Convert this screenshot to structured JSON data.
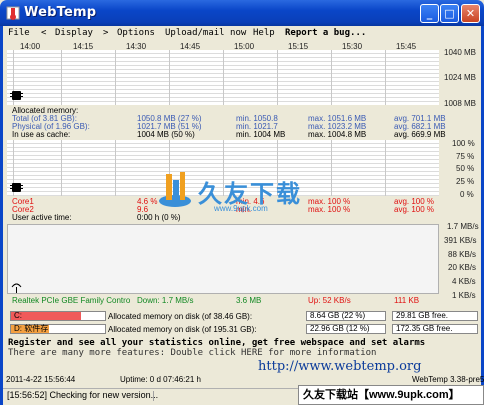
{
  "window": {
    "title": "WebTemp"
  },
  "menu": {
    "file": "File",
    "prev": "<",
    "display": "Display",
    "next": ">",
    "options": "Options",
    "upload": "Upload/mail now",
    "help": "Help",
    "report": "Report a bug..."
  },
  "timeline": [
    "14:00",
    "14:15",
    "14:30",
    "14:45",
    "15:00",
    "15:15",
    "15:30",
    "15:45"
  ],
  "memory_axis": [
    "1040 MB",
    "1024 MB",
    "1008 MB"
  ],
  "cpu_axis": [
    "100 %",
    "75 %",
    "50 %",
    "25 %",
    "0 %"
  ],
  "net_axis": [
    "1.7 MB/s",
    "391 KB/s",
    "88 KB/s",
    "20 KB/s",
    "4 KB/s",
    "1 KB/s"
  ],
  "memory": {
    "header": "Allocated memory:",
    "rows": [
      {
        "label": "Total (of 3.81 GB):",
        "value": "1050.8 MB (27 %)",
        "min": "min. 1050.8",
        "max": "max. 1051.6 MB",
        "avg": "avg. 701.1 MB"
      },
      {
        "label": "Physical (of 1.96 GB):",
        "value": "1021.7 MB (51 %)",
        "min": "min. 1021.7",
        "max": "max. 1023.2 MB",
        "avg": "avg. 682.1 MB"
      },
      {
        "label": "In use as cache:",
        "value": "1004 MB (50 %)",
        "min": "min. 1004 MB",
        "max": "max. 1004.8 MB",
        "avg": "avg. 669.9 MB"
      }
    ]
  },
  "cpu": {
    "rows": [
      {
        "label": "Core1",
        "value": "4.6 %",
        "min": "min. 4.6",
        "max": "max. 100 %",
        "avg": "avg. 100 %"
      },
      {
        "label": "Core2",
        "value": "9.6",
        "min": "min.",
        "max": "max. 100 %",
        "avg": "avg. 100 %"
      }
    ],
    "user_active_label": "User active time:",
    "user_active_value": "0:00 h (0 %)"
  },
  "network": {
    "adapter": "Realtek PCIe GBE Family Contro",
    "down": "Down: 1.7 MB/s",
    "down_total": "3.6 MB",
    "up": "Up: 52 KB/s",
    "up_total": "111 KB"
  },
  "disks": [
    {
      "letter": "C:",
      "label": "Allocated memory on disk (of 38.46 GB):",
      "used": "8.64 GB (22 %)",
      "free": "29.81 GB free.",
      "fill": 0.22
    },
    {
      "letter": "D: 软件存",
      "label": "Allocated memory on disk (of 195.31 GB):",
      "used": "22.96 GB (12 %)",
      "free": "172.35 GB free.",
      "fill": 0.12
    }
  ],
  "promo": {
    "line1": "Register and see all your statistics online, get free webspace and set alarms",
    "line2": "There are many more features: Double click HERE for more information",
    "url": "http://www.webtemp.org"
  },
  "footer": {
    "datetime": "2011-4-22 15:56:44",
    "uptime": "Uptime: 0 d 07:46:21 h",
    "version": "WebTemp 3.38-pre5"
  },
  "statusbar": {
    "message": "[15:56:52] Checking for new version..."
  },
  "watermark": {
    "text": "久友下载",
    "url": "www.9upk.com"
  },
  "banner": {
    "text": "久友下载站【www.9upk.com】"
  }
}
